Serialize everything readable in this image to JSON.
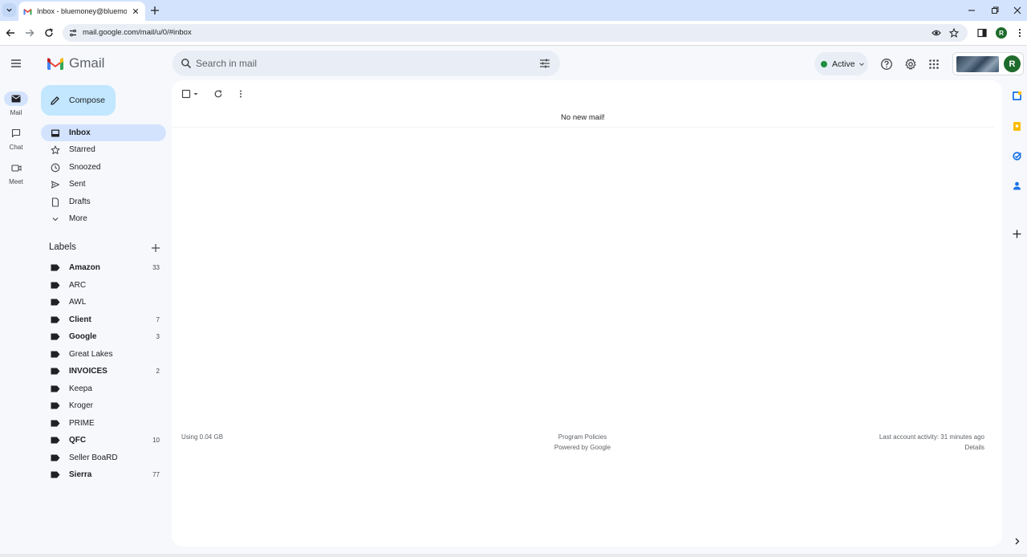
{
  "browser": {
    "tab_title": "Inbox - bluemoney@bluemoney",
    "url": "mail.google.com/mail/u/0/#inbox",
    "profile_initial": "R"
  },
  "header": {
    "app_name": "Gmail",
    "search_placeholder": "Search in mail",
    "status_label": "Active",
    "avatar_initial": "R"
  },
  "rail": {
    "items": [
      {
        "label": "Mail",
        "icon": "mail-icon"
      },
      {
        "label": "Chat",
        "icon": "chat-icon"
      },
      {
        "label": "Meet",
        "icon": "video-icon"
      }
    ]
  },
  "compose": {
    "label": "Compose"
  },
  "nav": {
    "items": [
      {
        "label": "Inbox",
        "icon": "inbox-icon"
      },
      {
        "label": "Starred",
        "icon": "star-icon"
      },
      {
        "label": "Snoozed",
        "icon": "clock-icon"
      },
      {
        "label": "Sent",
        "icon": "send-icon"
      },
      {
        "label": "Drafts",
        "icon": "draft-icon"
      },
      {
        "label": "More",
        "icon": "chevron-down-icon"
      }
    ]
  },
  "labels": {
    "title": "Labels",
    "items": [
      {
        "name": "Amazon",
        "count": "33"
      },
      {
        "name": "ARC",
        "count": ""
      },
      {
        "name": "AWL",
        "count": ""
      },
      {
        "name": "Client",
        "count": "7"
      },
      {
        "name": "Google",
        "count": "3"
      },
      {
        "name": "Great Lakes",
        "count": ""
      },
      {
        "name": "INVOICES",
        "count": "2"
      },
      {
        "name": "Keepa",
        "count": ""
      },
      {
        "name": "Kroger",
        "count": ""
      },
      {
        "name": "PRIME",
        "count": ""
      },
      {
        "name": "QFC",
        "count": "10"
      },
      {
        "name": "Seller BoaRD",
        "count": ""
      },
      {
        "name": "Sierra",
        "count": "77"
      }
    ]
  },
  "main": {
    "empty_message": "No new mail!",
    "storage": "Using 0.04 GB",
    "policies": "Program Policies",
    "powered_by": "Powered by Google",
    "last_activity": "Last account activity: 31 minutes ago",
    "details": "Details"
  },
  "colors": {
    "accent": "#c2e7ff",
    "selected": "#d3e3fd",
    "active_dot": "#1e8e3e",
    "avatar": "#1e6b2c"
  }
}
